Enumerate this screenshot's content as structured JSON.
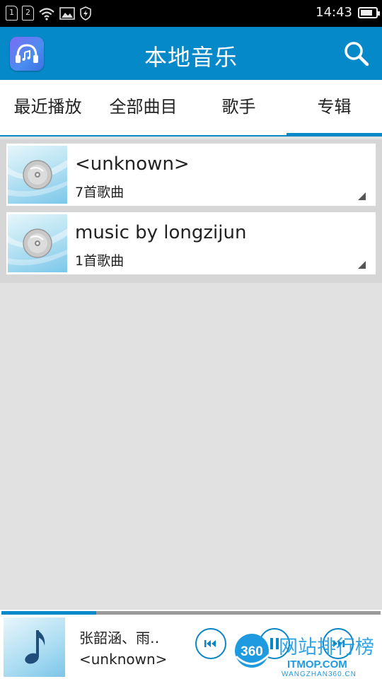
{
  "status_bar": {
    "sim1": "1",
    "sim2": "2",
    "time": "14:43",
    "battery_level": 0.85
  },
  "header": {
    "title": "本地音乐",
    "icons": [
      "app-logo-icon",
      "search-icon"
    ]
  },
  "tabs": [
    {
      "label": "最近播放",
      "active": false
    },
    {
      "label": "全部曲目",
      "active": false
    },
    {
      "label": "歌手",
      "active": false
    },
    {
      "label": "专辑",
      "active": true
    }
  ],
  "albums": [
    {
      "name": "<unknown>",
      "count": "7首歌曲"
    },
    {
      "name": "music by longzijun",
      "count": "1首歌曲"
    }
  ],
  "player": {
    "title": "张韶涵、雨‥",
    "artist": "<unknown>",
    "progress": 0.25,
    "accent": "#0689c9"
  },
  "watermark": {
    "text": "网站排行榜",
    "logo": "360",
    "site": "ITMOP.COM",
    "url": "WANGZHAN360.CN"
  }
}
